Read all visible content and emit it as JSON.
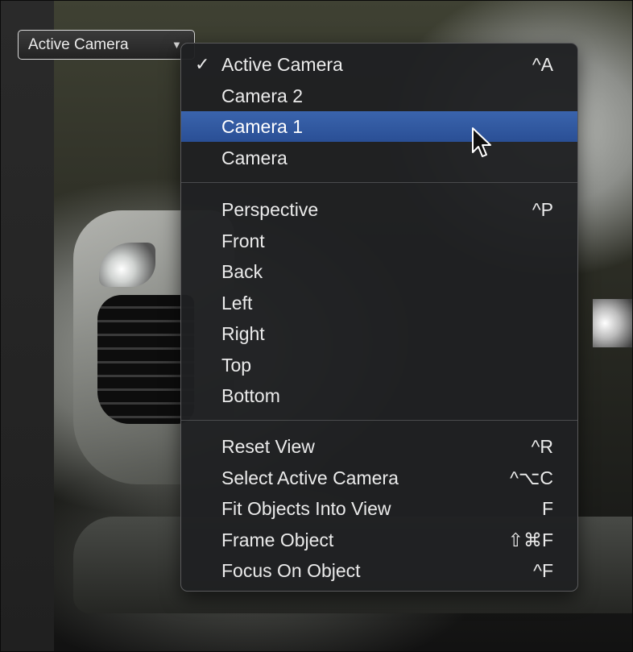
{
  "popup": {
    "label": "Active Camera",
    "arrow_icon": "triangle-down-icon"
  },
  "menu": {
    "group1": [
      {
        "label": "Active Camera",
        "shortcut": "^A",
        "checked": true,
        "check": "✓"
      },
      {
        "label": "Camera 2",
        "shortcut": ""
      },
      {
        "label": "Camera 1",
        "shortcut": "",
        "highlighted": true
      },
      {
        "label": "Camera",
        "shortcut": ""
      }
    ],
    "group2": [
      {
        "label": "Perspective",
        "shortcut": "^P"
      },
      {
        "label": "Front",
        "shortcut": ""
      },
      {
        "label": "Back",
        "shortcut": ""
      },
      {
        "label": "Left",
        "shortcut": ""
      },
      {
        "label": "Right",
        "shortcut": ""
      },
      {
        "label": "Top",
        "shortcut": ""
      },
      {
        "label": "Bottom",
        "shortcut": ""
      }
    ],
    "group3": [
      {
        "label": "Reset View",
        "shortcut": "^R"
      },
      {
        "label": "Select Active Camera",
        "shortcut": "^⌥C"
      },
      {
        "label": "Fit Objects Into View",
        "shortcut": "F"
      },
      {
        "label": "Frame Object",
        "shortcut": "⇧⌘F"
      },
      {
        "label": "Focus On Object",
        "shortcut": "^F"
      }
    ],
    "highlight_color": "#2f5aa3"
  },
  "cursor_icon": "arrow-pointer-icon"
}
